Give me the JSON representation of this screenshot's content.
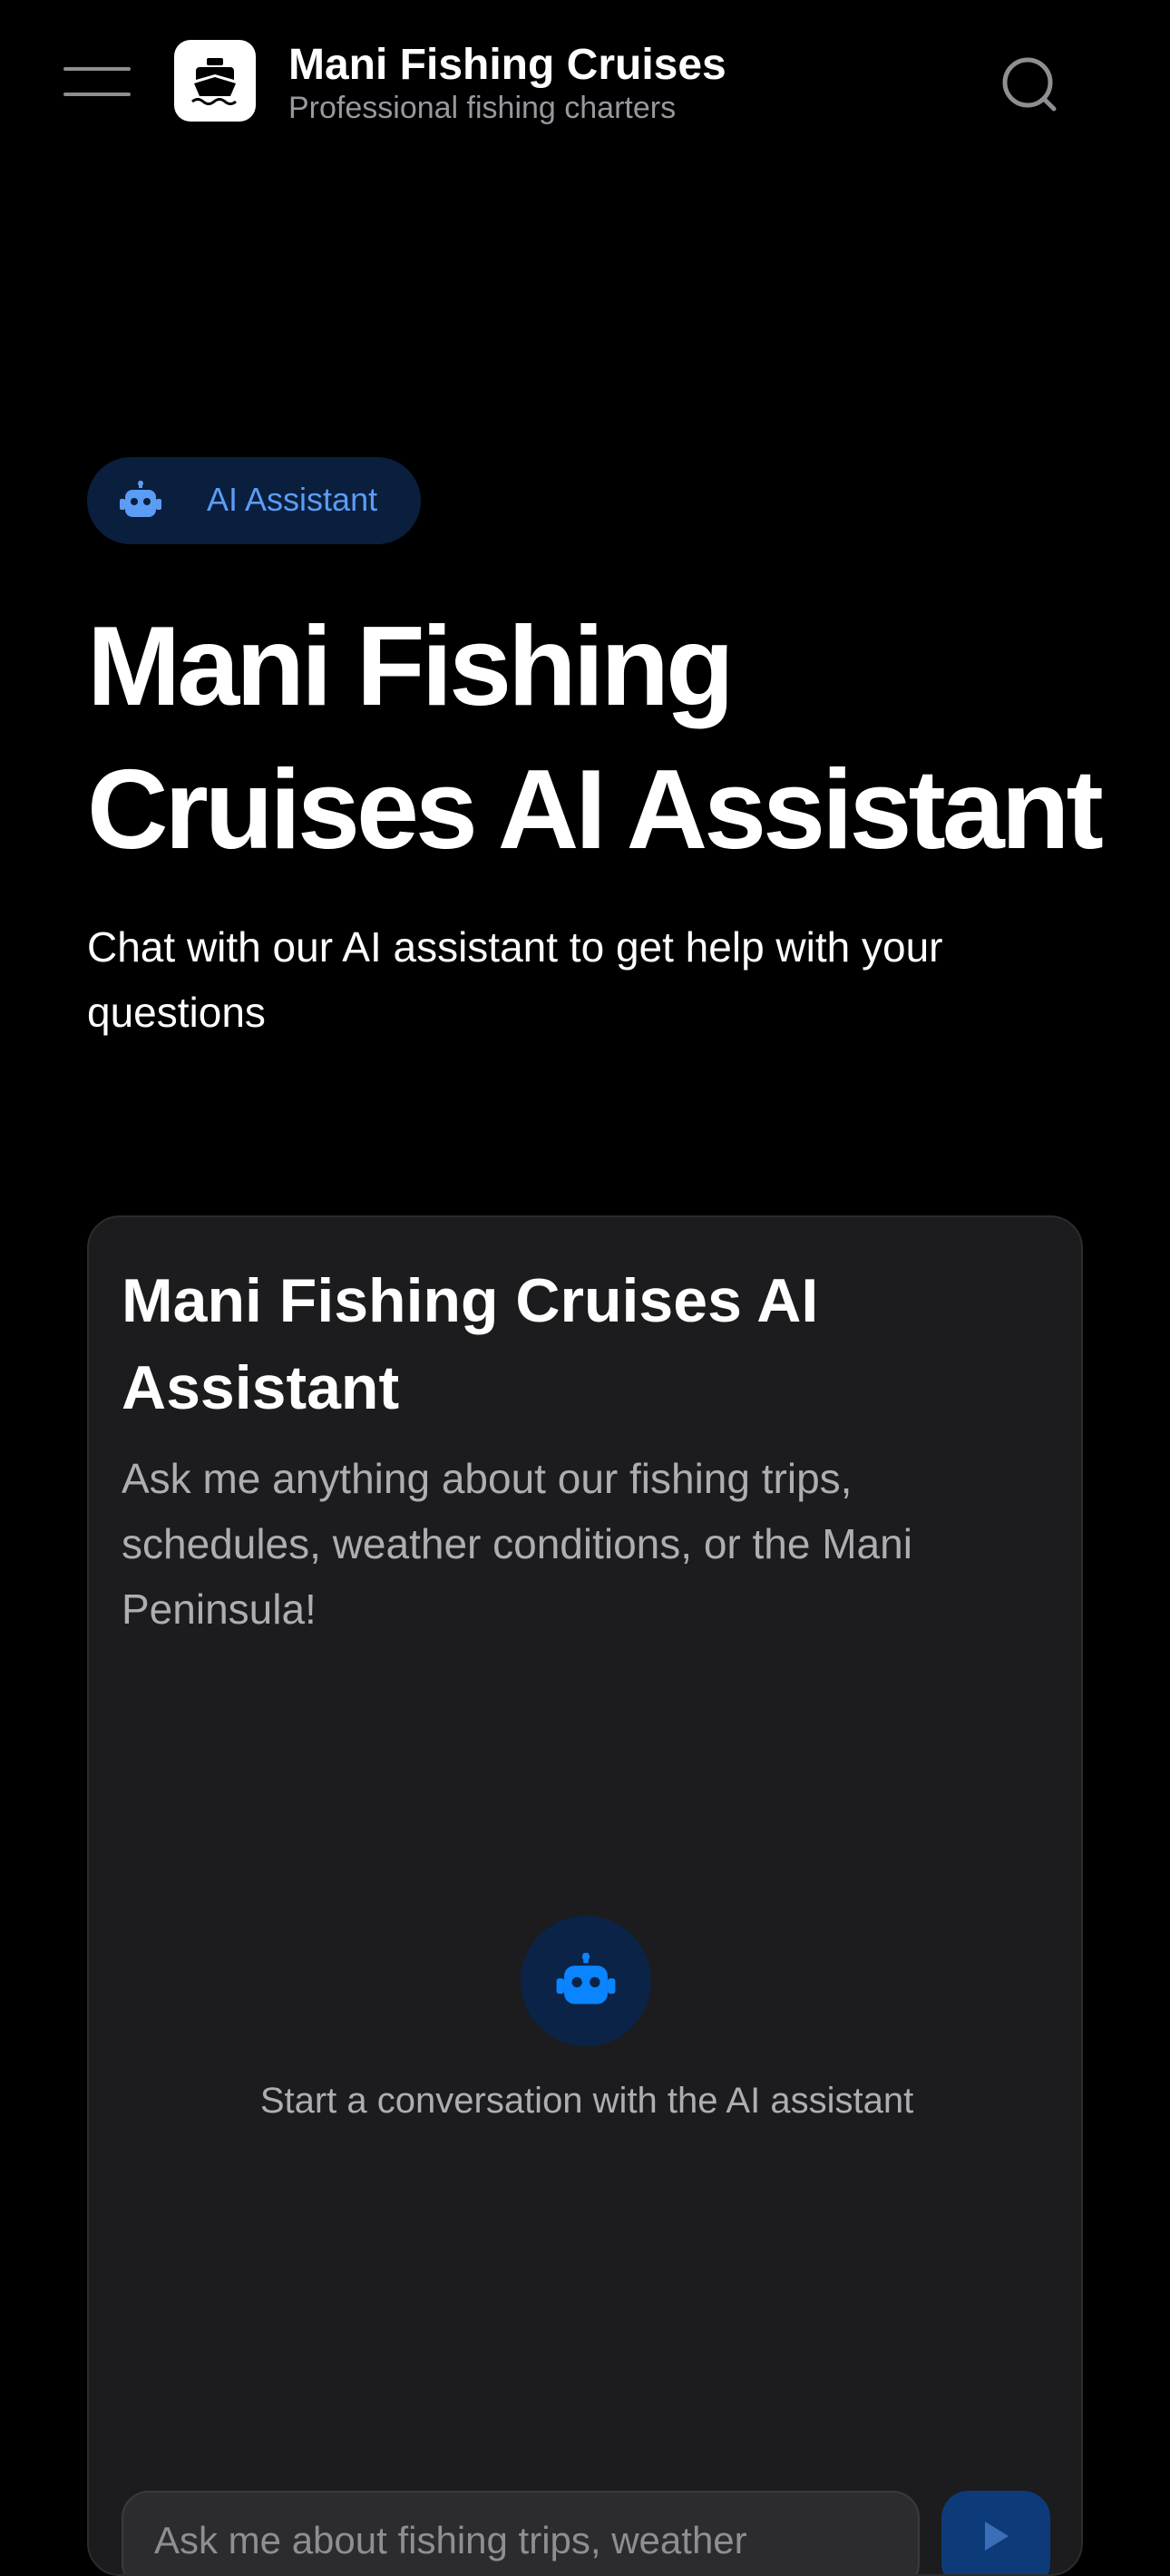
{
  "header": {
    "title": "Mani Fishing Cruises",
    "subtitle": "Professional fishing charters",
    "menu_icon": "hamburger-menu-icon",
    "logo_icon": "ship-icon",
    "search_icon": "search-icon"
  },
  "hero": {
    "badge_label": "AI Assistant",
    "badge_icon": "robot-icon",
    "title": "Mani Fishing Cruises AI Assistant",
    "subtitle": "Chat with our AI assistant to get help with your questions"
  },
  "chat_card": {
    "title": "Mani Fishing Cruises AI Assistant",
    "description": "Ask me anything about our fishing trips, schedules, weather conditions, or the Mani Peninsula!",
    "empty_state_icon": "robot-icon",
    "empty_state_text": "Start a conversation with the AI assistant",
    "input_placeholder": "Ask me about fishing trips, weather",
    "send_icon": "send-arrow-icon"
  },
  "colors": {
    "background": "#000000",
    "card": "#1c1c1e",
    "accent": "#0a84ff",
    "badge_bg": "#0a1e3d",
    "badge_text": "#5b9cf5",
    "muted_text": "#aeaeb2"
  }
}
